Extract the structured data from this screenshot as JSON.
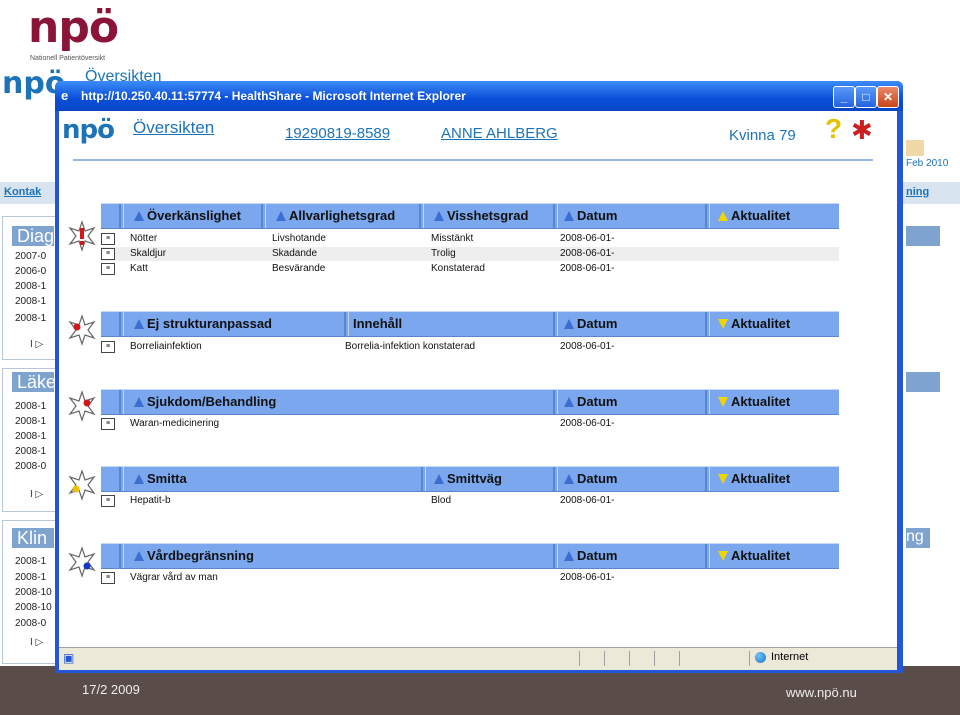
{
  "slide": {
    "logo": "npö",
    "logo_sub": "Nationell Patientöversikt",
    "footer_date": "17/2 2009",
    "footer_url": "www.npö.nu"
  },
  "background": {
    "logo": "npö",
    "title": "Översikten",
    "date_fragment": "Feb 2010",
    "tab_left": "Kontak",
    "tab_right": "ning",
    "sections": [
      {
        "head": "Diag",
        "lines": [
          "2007-0",
          "2006-0",
          "2008-1",
          "2008-1",
          "2008-1"
        ]
      },
      {
        "head": "Läke",
        "lines": [
          "2008-1",
          "2008-1",
          "2008-1",
          "2008-1",
          "2008-0"
        ]
      },
      {
        "head": "Klin",
        "lines": [
          "2008-1",
          "2008-1",
          "2008-10",
          "2008-10",
          "2008-0"
        ]
      }
    ],
    "right_head": "ng"
  },
  "window": {
    "title": "http://10.250.40.11:57774 - HealthShare - Microsoft Internet Explorer",
    "status_zone": "Internet"
  },
  "page": {
    "logo": "npö",
    "title": "Översikten",
    "personnummer": "19290819-8589",
    "patient_name": "ANNE AHLBERG",
    "gender_age": "Kvinna 79"
  },
  "tables": [
    {
      "name": "overkanslighet",
      "headers": [
        "Överkänslighet",
        "Allvarlighetsgrad",
        "Visshetsgrad",
        "Datum",
        "Aktualitet"
      ],
      "rows": [
        [
          "Nötter",
          "Livshotande",
          "Misstänkt",
          "2008-06-01-"
        ],
        [
          "Skaldjur",
          "Skadande",
          "Trolig",
          "2008-06-01-"
        ],
        [
          "Katt",
          "Besvärande",
          "Konstaterad",
          "2008-06-01-"
        ]
      ]
    },
    {
      "name": "ej-strukturanpassad",
      "headers": [
        "Ej strukturanpassad",
        "Innehåll",
        "Datum",
        "Aktualitet"
      ],
      "rows": [
        [
          "Borreliainfektion",
          "Borrelia-infektion konstaterad",
          "2008-06-01-"
        ]
      ]
    },
    {
      "name": "sjukdom-behandling",
      "headers": [
        "Sjukdom/Behandling",
        "Datum",
        "Aktualitet"
      ],
      "rows": [
        [
          "Waran-medicinering",
          "2008-06-01-"
        ]
      ]
    },
    {
      "name": "smitta",
      "headers": [
        "Smitta",
        "Smittväg",
        "Datum",
        "Aktualitet"
      ],
      "rows": [
        [
          "Hepatit-b",
          "Blod",
          "2008-06-01-"
        ]
      ]
    },
    {
      "name": "vardbegransning",
      "headers": [
        "Vårdbegränsning",
        "Datum",
        "Aktualitet"
      ],
      "rows": [
        [
          "Vägrar vård av man",
          "2008-06-01-"
        ]
      ]
    }
  ],
  "colors": {
    "brand": "#8b1538",
    "link": "#1d73b8",
    "header_bar": "#7aa7ee",
    "titlebar": "#0a4ed8",
    "footer": "#5a4c48"
  }
}
